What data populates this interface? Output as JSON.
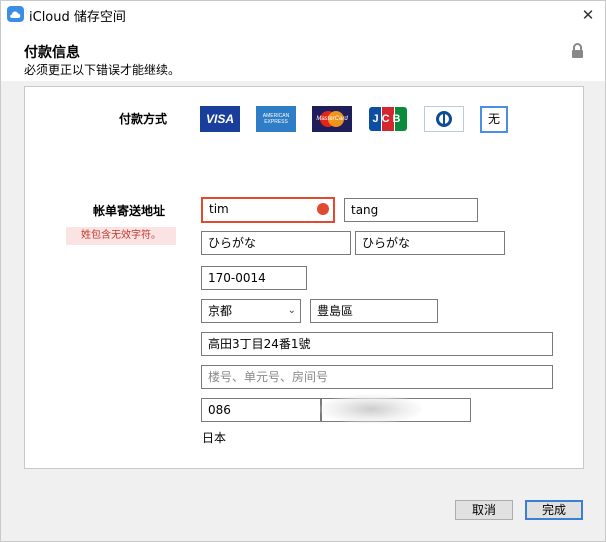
{
  "window": {
    "title": "iCloud 储存空间",
    "close_glyph": "✕"
  },
  "header": {
    "title": "付款信息",
    "subtitle": "必须更正以下错误才能继续。"
  },
  "payment": {
    "label": "付款方式",
    "cards": [
      {
        "name": "visa",
        "text": "VISA"
      },
      {
        "name": "amex",
        "text": "AMERICAN EXPRESS"
      },
      {
        "name": "mastercard",
        "text": "MasterCard"
      },
      {
        "name": "jcb",
        "text": "JCB"
      },
      {
        "name": "diners",
        "text": ""
      }
    ],
    "none_label": "无"
  },
  "billing": {
    "label": "帐单寄送地址",
    "error": "姓包含无效字符。",
    "first_name": "tim",
    "last_name": "tang",
    "first_name_phonetic_placeholder": "ひらがな",
    "last_name_phonetic_placeholder": "ひらがな",
    "postal_code": "170-0014",
    "prefecture": "京都",
    "city": "豊島區",
    "address_line1": "高田3丁目24番1號",
    "address_line2_placeholder": "楼号、单元号、房间号",
    "phone_prefix": "086",
    "country": "日本"
  },
  "footer": {
    "cancel_label": "取消",
    "done_label": "完成"
  },
  "colors": {
    "accent": "#3c7fd9",
    "error": "#e04a2f",
    "visa": "#1a3e9c"
  }
}
